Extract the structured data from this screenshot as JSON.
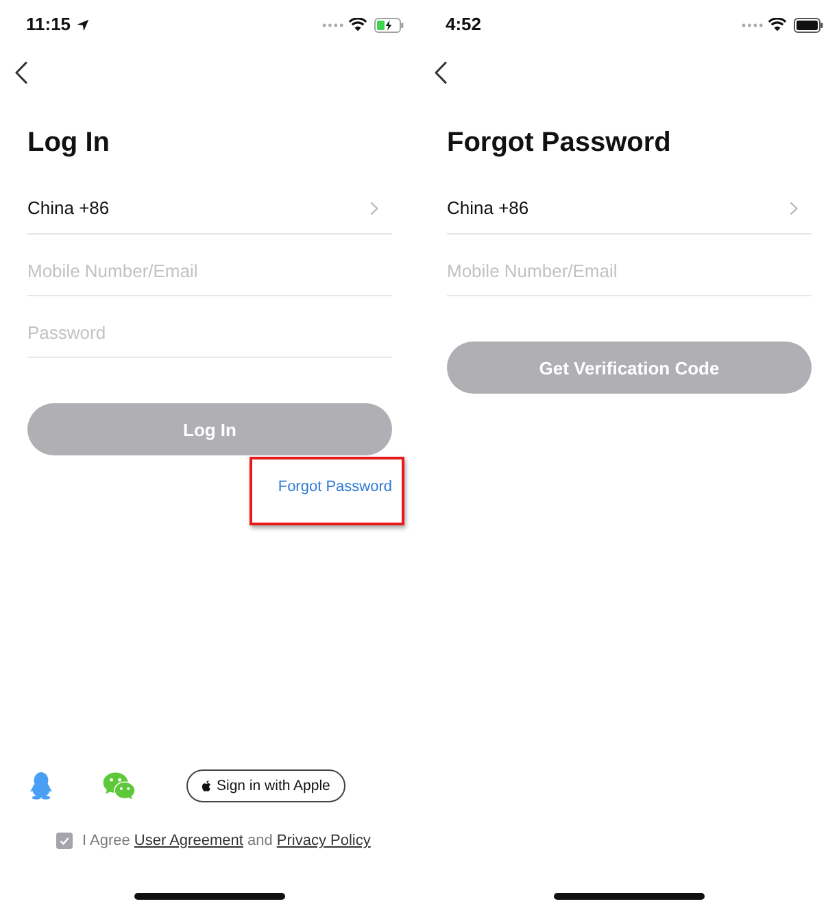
{
  "screens": [
    {
      "status_bar": {
        "time": "11:15",
        "location_shown": true,
        "battery_charging": true
      },
      "title": "Log In",
      "country": {
        "label": "China +86"
      },
      "fields": [
        {
          "placeholder": "Mobile Number/Email"
        },
        {
          "placeholder": "Password"
        }
      ],
      "primary_button": {
        "label": "Log In",
        "disabled": true
      },
      "forgot_link": {
        "label": "Forgot Password",
        "highlighted": true
      },
      "social": [
        {
          "kind": "penguin"
        },
        {
          "kind": "bubbles"
        },
        {
          "kind": "apple",
          "label": "Sign in with Apple"
        }
      ],
      "agreement": {
        "checked": true,
        "parts": [
          {
            "kind": "text",
            "text": "I Agree"
          },
          {
            "kind": "link",
            "text": "User Agreement"
          },
          {
            "kind": "text",
            "text": "and"
          },
          {
            "kind": "link",
            "text": "Privacy Policy"
          }
        ]
      }
    },
    {
      "status_bar": {
        "time": "4:52",
        "battery_charging": false
      },
      "title": "Forgot Password",
      "country": {
        "label": "China +86"
      },
      "fields": [
        {
          "placeholder": "Mobile Number/Email"
        }
      ],
      "primary_button": {
        "label": "Get Verification Code",
        "disabled": true
      }
    }
  ]
}
